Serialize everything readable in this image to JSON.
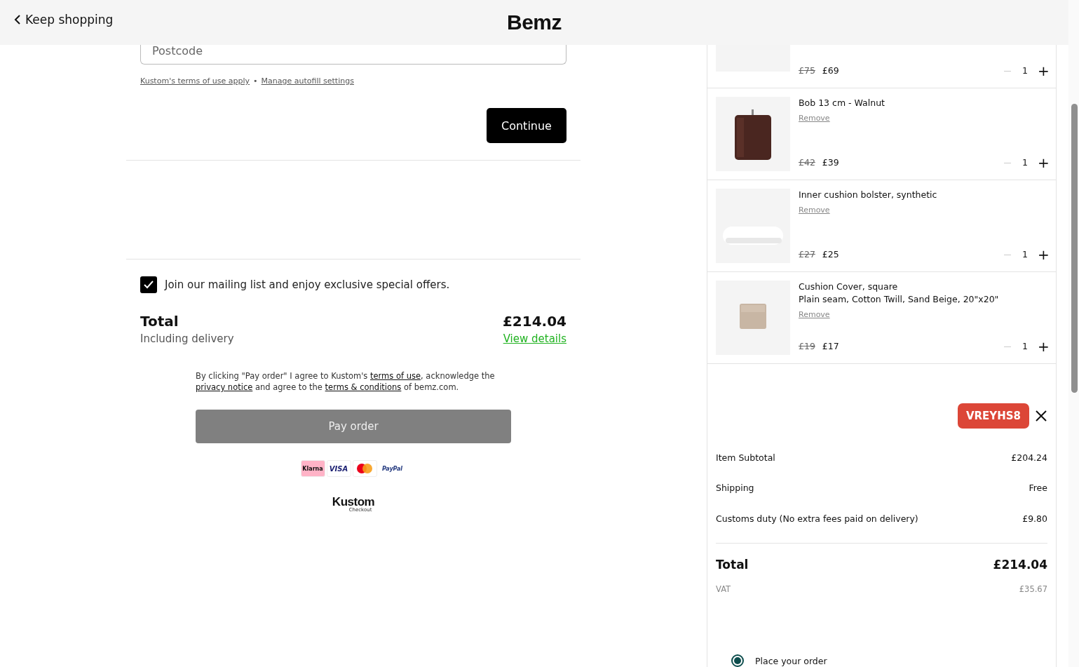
{
  "header": {
    "back_link": "Keep shopping",
    "logo": "Bemz"
  },
  "address_form": {
    "postcode": {
      "placeholder": "Postcode"
    },
    "links": [
      "Kustom's terms of use apply",
      "Manage autofill settings"
    ],
    "separator": "•",
    "continue_button": "Continue"
  },
  "newsletter": {
    "label": "Join our mailing list and enjoy exclusive special offers.",
    "checked": true
  },
  "total": {
    "label": "Total",
    "amount": "£214.04",
    "note": "Including delivery",
    "details_link": "View details"
  },
  "legal": {
    "parts": [
      {
        "kind": "text",
        "text": "By clicking \"Pay order\" I agree to Kustom's "
      },
      {
        "kind": "link",
        "text": "terms of use"
      },
      {
        "kind": "text",
        "text": ", acknowledge the "
      },
      {
        "kind": "link",
        "text": "privacy notice"
      },
      {
        "kind": "text",
        "text": " and agree to the "
      },
      {
        "kind": "link",
        "text": "terms & conditions"
      },
      {
        "kind": "text",
        "text": " of bemz.com."
      }
    ]
  },
  "pay_button": {
    "label": "Pay order",
    "disabled": true
  },
  "payment_methods": [
    {
      "kind": "klarna",
      "label": "Klarna"
    },
    {
      "kind": "visa",
      "label": "VISA"
    },
    {
      "kind": "mastercard"
    },
    {
      "kind": "paypal",
      "label": "PayPal"
    }
  ],
  "provider": {
    "name": "Kustom",
    "sub": "Checkout"
  },
  "cart": {
    "items": [
      {
        "kind": "blanket",
        "old_price": "£75",
        "price": "£69",
        "quantity": "1",
        "minus": "—",
        "plus": "+"
      },
      {
        "kind": "leg",
        "name": "Bob 13 cm - Walnut",
        "remove": "Remove",
        "old_price": "£42",
        "price": "£39",
        "quantity": "1",
        "minus": "—",
        "plus": "+"
      },
      {
        "kind": "bolster",
        "name": "Inner cushion bolster, synthetic",
        "remove": "Remove",
        "old_price": "£27",
        "price": "£25",
        "quantity": "1",
        "minus": "—",
        "plus": "+"
      },
      {
        "kind": "cushion",
        "name": "Cushion Cover, square",
        "lines": [
          "Plain seam, Cotton Twill, Sand Beige, 20\"x20\""
        ],
        "remove": "Remove",
        "old_price": "£19",
        "price": "£17",
        "quantity": "1",
        "minus": "—",
        "plus": "+"
      }
    ],
    "coupon": "VREYHS8",
    "summary": [
      {
        "label": "Item Subtotal",
        "value": "£204.24"
      },
      {
        "label": "Shipping",
        "value": "Free"
      },
      {
        "label": "Customs duty (No extra fees paid on delivery)",
        "value": "£9.80"
      }
    ],
    "total": {
      "label": "Total",
      "value": "£214.04"
    },
    "vat": {
      "label": "VAT",
      "value": "£35.67"
    },
    "options": [
      {
        "label": "Place your order",
        "selected": true
      }
    ]
  }
}
